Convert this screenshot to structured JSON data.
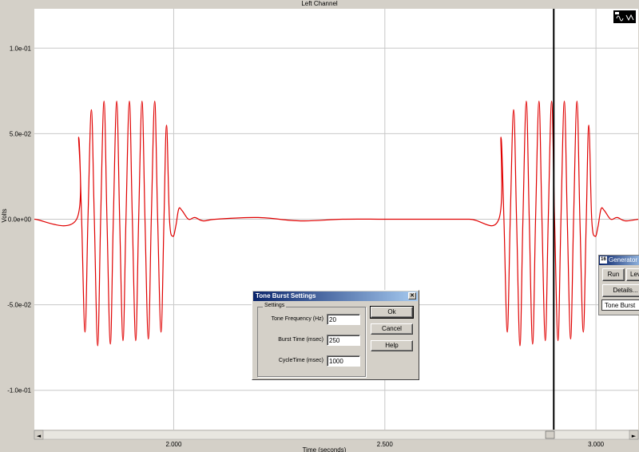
{
  "chart_data": {
    "type": "line",
    "title": "Left Channel",
    "xlabel": "Time (seconds)",
    "ylabel": "Volts",
    "xlim": [
      1.67,
      3.1
    ],
    "ylim": [
      -0.123,
      0.123
    ],
    "x_ticks": [
      2.0,
      2.5,
      3.0
    ],
    "x_tick_labels": [
      "2.000",
      "2.500",
      "3.000"
    ],
    "y_ticks": [
      0.1,
      0.05,
      0.0,
      -0.05,
      -0.1
    ],
    "y_tick_labels": [
      "1.0e-01",
      "5.0e-02",
      "0.0e+00",
      "-5.0e-02",
      "-1.0e-01"
    ],
    "grid": true,
    "cursor_x": 2.9,
    "series": [
      {
        "name": "",
        "color": "#e00000",
        "x": [
          1.67,
          1.77,
          1.775,
          1.782,
          1.79,
          1.797,
          1.805,
          1.812,
          1.82,
          1.827,
          1.835,
          1.842,
          1.85,
          1.857,
          1.865,
          1.872,
          1.88,
          1.887,
          1.895,
          1.902,
          1.91,
          1.917,
          1.925,
          1.932,
          1.94,
          1.947,
          1.955,
          1.962,
          1.97,
          1.977,
          1.983,
          1.99,
          1.998,
          2.005,
          2.012,
          2.02,
          2.035,
          2.05,
          2.07,
          2.1,
          2.2,
          2.3,
          2.4,
          2.5,
          2.6,
          2.7,
          2.77,
          2.775,
          2.782,
          2.79,
          2.797,
          2.805,
          2.812,
          2.82,
          2.827,
          2.835,
          2.842,
          2.85,
          2.857,
          2.865,
          2.872,
          2.88,
          2.887,
          2.895,
          2.902,
          2.91,
          2.917,
          2.925,
          2.932,
          2.94,
          2.947,
          2.955,
          2.962,
          2.97,
          2.977,
          2.983,
          2.99,
          2.998,
          3.005,
          3.012,
          3.02,
          3.035,
          3.05,
          3.07,
          3.1
        ],
        "y": [
          0.0,
          0.0,
          0.048,
          0.0,
          -0.066,
          0.0,
          0.064,
          0.0,
          -0.074,
          0.0,
          0.069,
          0.0,
          -0.073,
          0.0,
          0.069,
          0.0,
          -0.071,
          0.0,
          0.069,
          0.0,
          -0.071,
          0.0,
          0.069,
          0.0,
          -0.07,
          0.0,
          0.069,
          0.0,
          -0.066,
          0.0,
          0.055,
          0.0,
          -0.01,
          -0.004,
          0.006,
          0.005,
          0.0,
          0.001,
          -0.001,
          0.0,
          0.001,
          -0.001,
          0.0,
          0.0,
          0.0,
          0.0,
          0.0,
          0.048,
          0.0,
          -0.066,
          0.0,
          0.064,
          0.0,
          -0.074,
          0.0,
          0.069,
          0.0,
          -0.073,
          0.0,
          0.069,
          0.0,
          -0.071,
          0.0,
          0.069,
          0.0,
          -0.071,
          0.0,
          0.069,
          0.0,
          -0.07,
          0.0,
          0.069,
          0.0,
          -0.066,
          0.0,
          0.055,
          0.0,
          -0.01,
          -0.004,
          0.006,
          0.005,
          0.0,
          0.001,
          -0.001,
          0.0
        ]
      }
    ]
  },
  "dialog": {
    "title": "Tone Burst Settings",
    "close_glyph": "✕",
    "group_label": "Settings",
    "fields": [
      {
        "label": "Tone Frequency (Hz)",
        "value": "20"
      },
      {
        "label": "Burst Time (msec)",
        "value": "250"
      },
      {
        "label": "CycleTime (msec)",
        "value": "1000"
      }
    ],
    "ok_label": "Ok",
    "cancel_label": "Cancel",
    "help_label": "Help"
  },
  "generator": {
    "title": "Generator",
    "icon_text": "16",
    "run_label": "Run",
    "level_label": "Lev",
    "details_label": "Details...",
    "selected": "Tone Burst"
  },
  "scrollbar": {
    "left_arrow": "◄",
    "right_arrow": "►",
    "position": 0.87
  },
  "toolbar_icon": "waveform-icon"
}
